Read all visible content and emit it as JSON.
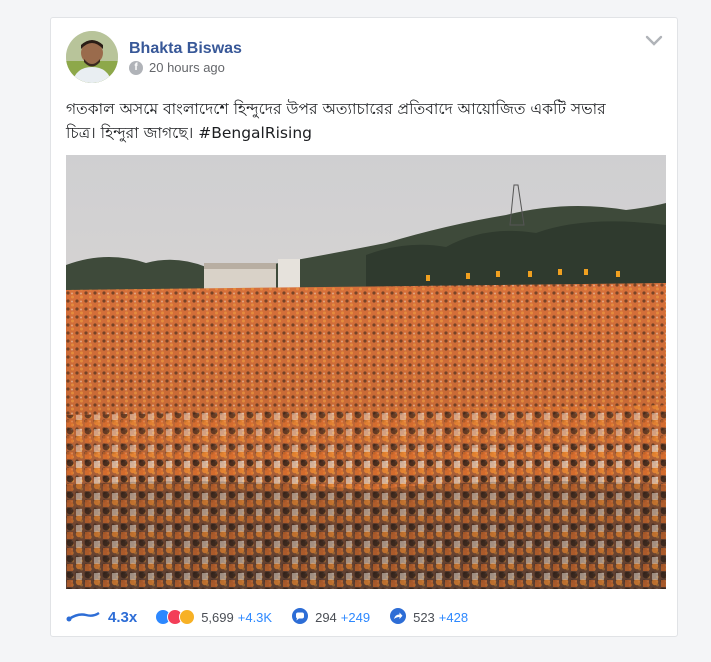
{
  "post": {
    "author": "Bhakta Biswas",
    "timestamp": "20 hours ago",
    "text_line1": "গতকাল অসমে বাংলাদেশে হিন্দুদের উপর অত্যাচারের প্রতিবাদে আয়োজিত একটি সভার",
    "text_line2": "চিত্র। হিন্দুরা জাগছে। ",
    "hashtag": "#BengalRising"
  },
  "stats": {
    "multiplier": "4.3x",
    "reactions": "5,699",
    "reactions_growth": "+4.3K",
    "comments": "294",
    "comments_growth": "+249",
    "shares": "523",
    "shares_growth": "+428"
  },
  "colors": {
    "link_blue": "#385898",
    "stat_blue": "#2d6dd6",
    "crowd_orange": "#e07a2c"
  },
  "icons": {
    "platform": "facebook-icon",
    "menu": "chevron-down-icon",
    "trend": "trend-line-icon",
    "comment": "comment-bubble-icon",
    "share": "share-arrow-icon"
  }
}
